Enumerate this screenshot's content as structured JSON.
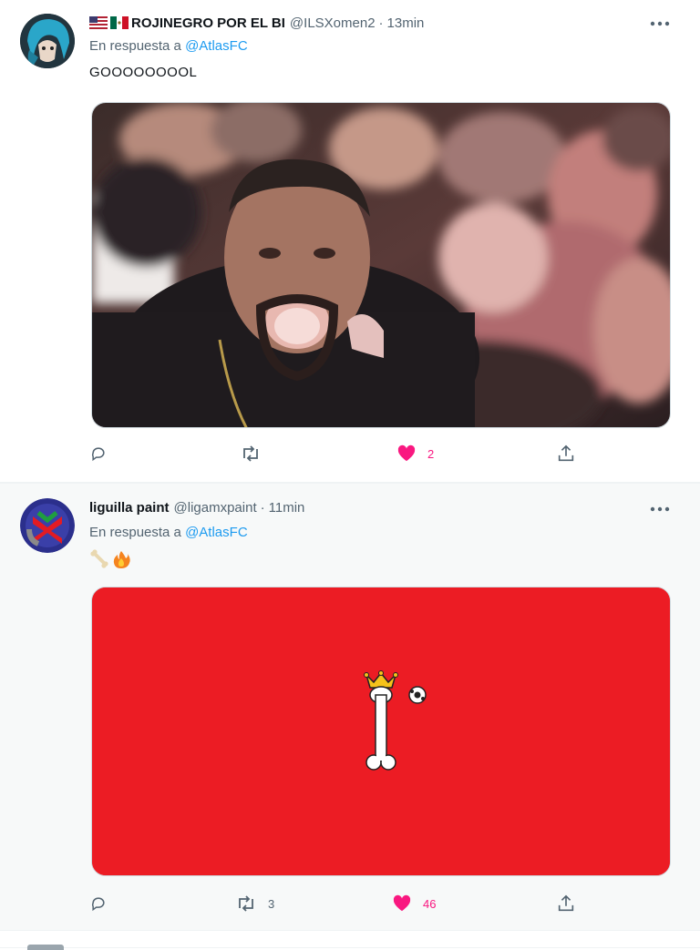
{
  "tweets": [
    {
      "author_flags": [
        "us-flag",
        "mexico-flag"
      ],
      "author_name": "ROJINEGRO POR EL BI",
      "author_handle": "@ILSXomen2",
      "time": "13min",
      "reply_prefix": "En respuesta a",
      "reply_mention": "@AtlasFC",
      "text": "GOOOOOOOOL",
      "media": "blurry photo of a man shouting in a crowd",
      "replies": "",
      "retweets": "",
      "likes": "2",
      "liked": true
    },
    {
      "author_name": "liguilla paint",
      "author_handle": "@ligamxpaint",
      "time": "11min",
      "reply_prefix": "En respuesta a",
      "reply_mention": "@AtlasFC",
      "text_emojis": [
        "bone-emoji",
        "fire-emoji"
      ],
      "media": "red image with crowned bone and soccer ball",
      "replies": "",
      "retweets": "3",
      "likes": "46",
      "liked": true
    }
  ],
  "colors": {
    "accent": "#1d9bf0",
    "like": "#f91880",
    "muted": "#536471",
    "media_red": "#ec1c24"
  }
}
